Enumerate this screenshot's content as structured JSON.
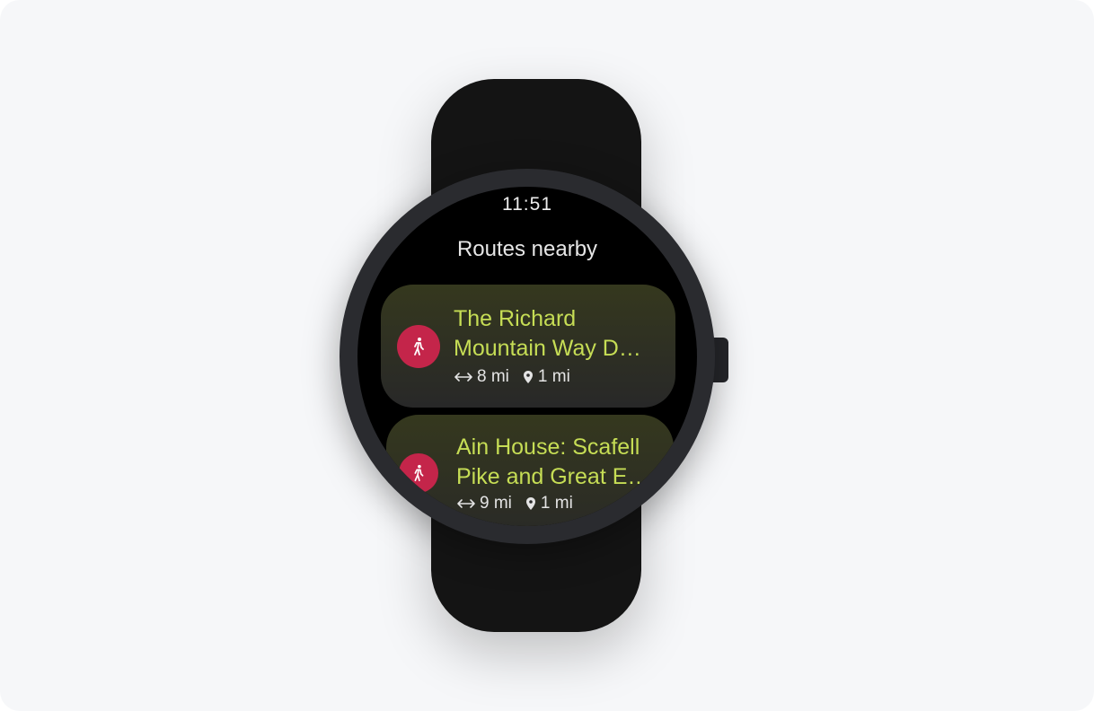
{
  "watch": {
    "time": "11:51",
    "screen_title": "Routes nearby"
  },
  "routes": [
    {
      "name_line1": "The Richard",
      "name_line2": "Mountain Way D…",
      "distance": "8 mi",
      "proximity": "1 mi",
      "icon": "walking-person-icon"
    },
    {
      "name_line1": "Ain House: Scafell",
      "name_line2": "Pike and Great E…",
      "distance": "9 mi",
      "proximity": "1 mi",
      "icon": "walking-person-icon"
    }
  ],
  "colors": {
    "badge": "#c4254a",
    "route_name": "#c6dd55",
    "card_top": "#35381e",
    "card_bottom": "#282828"
  }
}
